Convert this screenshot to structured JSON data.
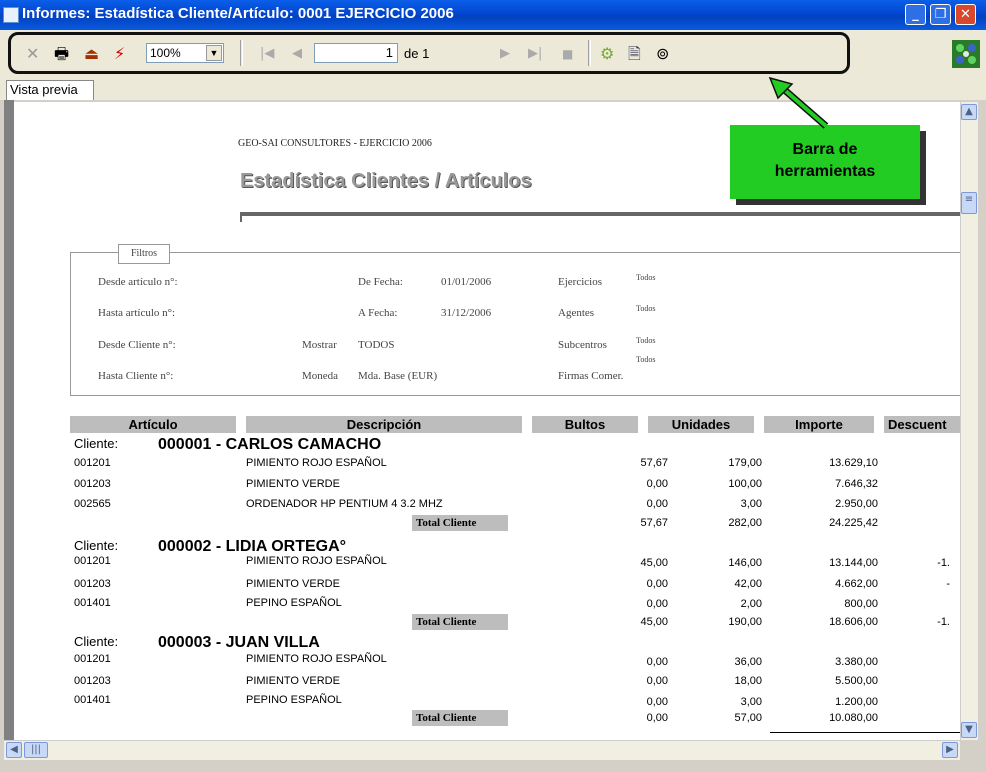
{
  "window": {
    "title": "Informes: Estadística Cliente/Artículo: 0001 EJERCICIO 2006"
  },
  "toolbar": {
    "zoom": "100%",
    "page_current": "1",
    "page_of": "de 1"
  },
  "tab": {
    "label": "Vista previa"
  },
  "callout": {
    "text_line1": "Barra de",
    "text_line2": "herramientas"
  },
  "report": {
    "company": "GEO-SAI CONSULTORES - EJERCICIO 2006",
    "title": "Estadística Clientes / Artículos",
    "filters_label": "Filtros",
    "filters": {
      "desde_articulo": "Desde artículo n°:",
      "hasta_articulo": "Hasta artículo n°:",
      "desde_cliente": "Desde Cliente n°:",
      "hasta_cliente": "Hasta Cliente n°:",
      "de_fecha_lbl": "De Fecha:",
      "de_fecha": "01/01/2006",
      "a_fecha_lbl": "A Fecha:",
      "a_fecha": "31/12/2006",
      "mostrar_lbl": "Mostrar",
      "mostrar": "TODOS",
      "moneda_lbl": "Moneda",
      "moneda": "Mda. Base (EUR)",
      "ejercicios": "Ejercicios",
      "ejercicios_val": "Todos",
      "agentes": "Agentes",
      "agentes_val": "Todos",
      "subcentros": "Subcentros",
      "subcentros_val": "Todos",
      "firmas": "Firmas Comer.",
      "firmas_val": "Todos"
    },
    "columns": {
      "articulo": "Artículo",
      "descripcion": "Descripción",
      "bultos": "Bultos",
      "unidades": "Unidades",
      "importe": "Importe",
      "descuento": "Descuent"
    },
    "client_label": "Cliente:",
    "total_label": "Total Cliente",
    "clients": [
      {
        "name": "000001 - CARLOS CAMACHO",
        "rows": [
          {
            "art": "001201",
            "desc": "PIMIENTO ROJO ESPAÑOL",
            "bultos": "57,67",
            "unidades": "179,00",
            "importe": "13.629,10",
            "desc2": ""
          },
          {
            "art": "001203",
            "desc": "PIMIENTO VERDE",
            "bultos": "0,00",
            "unidades": "100,00",
            "importe": "7.646,32",
            "desc2": ""
          },
          {
            "art": "002565",
            "desc": "ORDENADOR HP PENTIUM 4 3.2 MHZ",
            "bultos": "0,00",
            "unidades": "3,00",
            "importe": "2.950,00",
            "desc2": ""
          }
        ],
        "total": {
          "bultos": "57,67",
          "unidades": "282,00",
          "importe": "24.225,42",
          "desc2": ""
        }
      },
      {
        "name": "000002 - LIDIA ORTEGA°",
        "rows": [
          {
            "art": "001201",
            "desc": "PIMIENTO ROJO ESPAÑOL",
            "bultos": "45,00",
            "unidades": "146,00",
            "importe": "13.144,00",
            "desc2": "-1."
          },
          {
            "art": "001203",
            "desc": "PIMIENTO VERDE",
            "bultos": "0,00",
            "unidades": "42,00",
            "importe": "4.662,00",
            "desc2": "-"
          },
          {
            "art": "001401",
            "desc": "PEPINO ESPAÑOL",
            "bultos": "0,00",
            "unidades": "2,00",
            "importe": "800,00",
            "desc2": ""
          }
        ],
        "total": {
          "bultos": "45,00",
          "unidades": "190,00",
          "importe": "18.606,00",
          "desc2": "-1."
        }
      },
      {
        "name": "000003 - JUAN VILLA",
        "rows": [
          {
            "art": "001201",
            "desc": "PIMIENTO ROJO ESPAÑOL",
            "bultos": "0,00",
            "unidades": "36,00",
            "importe": "3.380,00",
            "desc2": ""
          },
          {
            "art": "001203",
            "desc": "PIMIENTO VERDE",
            "bultos": "0,00",
            "unidades": "18,00",
            "importe": "5.500,00",
            "desc2": ""
          },
          {
            "art": "001401",
            "desc": "PEPINO ESPAÑOL",
            "bultos": "0,00",
            "unidades": "3,00",
            "importe": "1.200,00",
            "desc2": ""
          }
        ],
        "total": {
          "bultos": "0,00",
          "unidades": "57,00",
          "importe": "10.080,00",
          "desc2": ""
        }
      }
    ]
  }
}
